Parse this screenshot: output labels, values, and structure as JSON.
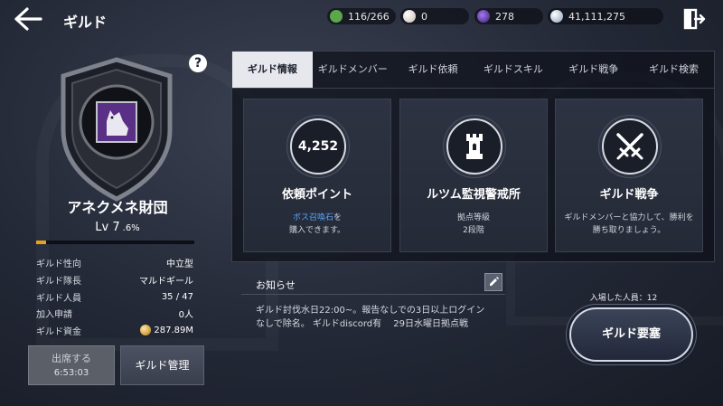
{
  "header": {
    "title": "ギルド",
    "resources": [
      {
        "icon": "stamina-icon",
        "value": "116/266",
        "color": "#5aa84a"
      },
      {
        "icon": "pearl-icon",
        "value": "0",
        "color": "#e4d8d0"
      },
      {
        "icon": "dark-gem-icon",
        "value": "278",
        "color": "#6a3ab8"
      },
      {
        "icon": "silver-coin-icon",
        "value": "41,111,275",
        "color": "#b9c8dc"
      }
    ]
  },
  "guild": {
    "name": "アネクメネ財団",
    "level": "Lv 7",
    "exp_percent": ".6%",
    "exp_fill": 0.06,
    "info": [
      {
        "key": "ギルド性向",
        "value": "中立型"
      },
      {
        "key": "ギルド隊長",
        "value": "マルドギール"
      },
      {
        "key": "ギルド人員",
        "value": "35 / 47"
      },
      {
        "key": "加入申請",
        "value": "0人"
      },
      {
        "key": "ギルド資金",
        "value": "287.89M"
      }
    ],
    "help_label": "?"
  },
  "buttons": {
    "attend_label": "出席する",
    "attend_timer": "6:53:03",
    "manage_label": "ギルド管理",
    "fortress_label": "ギルド要塞"
  },
  "tabs": [
    {
      "label": "ギルド情報",
      "active": true
    },
    {
      "label": "ギルドメンバー"
    },
    {
      "label": "ギルド依頼"
    },
    {
      "label": "ギルドスキル"
    },
    {
      "label": "ギルド戦争"
    },
    {
      "label": "ギルド検索"
    }
  ],
  "cards": [
    {
      "value": "4,252",
      "title": "依頼ポイント",
      "line1_highlight": "ボス召喚石",
      "line1_rest": "を",
      "line2": "購入できます。"
    },
    {
      "icon": "tower-icon",
      "title": "ルツム監視警戒所",
      "line1": "拠点等級",
      "line2": "2段階"
    },
    {
      "icon": "crossed-swords-icon",
      "title": "ギルド戦争",
      "line1": "ギルドメンバーと協力して、勝利を",
      "line2": "勝ち取りましょう。"
    }
  ],
  "notice": {
    "title": "お知らせ",
    "lines": [
      "ギルド討伐水日22:00~。報告なしでの3日以上ログイン",
      "なしで除名。 ギルドdiscord有　 29日水曜日拠点戦"
    ]
  },
  "entered": "入場した人員：12"
}
